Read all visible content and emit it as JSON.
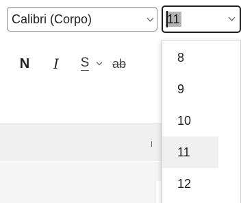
{
  "toolbar": {
    "font_name": {
      "value": "Calibri (Corpo)",
      "dropdown_icon": "chevron-down-icon"
    },
    "font_size": {
      "value": "11",
      "dropdown_icon": "chevron-down-icon"
    }
  },
  "formatting": {
    "bold_label": "N",
    "italic_label": "I",
    "underline_label": "S",
    "underline_dropdown_icon": "chevron-down-icon",
    "strikethrough_label": "ab"
  },
  "size_dropdown": {
    "options": [
      "8",
      "9",
      "10",
      "11",
      "12"
    ],
    "highlighted": "11"
  },
  "colors": {
    "selection_bg": "#b3b3b3",
    "hover_bg": "#f0f0f0",
    "ribbon_bg": "#f0f0f0"
  }
}
